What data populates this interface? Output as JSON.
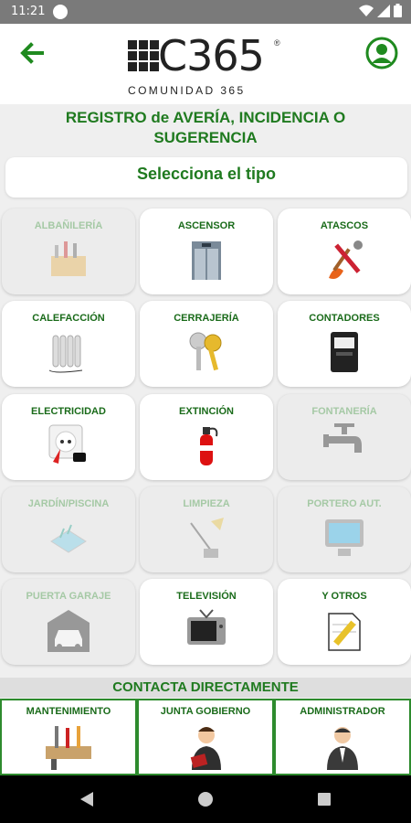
{
  "status": {
    "time": "11:21"
  },
  "app": {
    "logo_text": "C365",
    "logo_reg": "®",
    "logo_sub": "COMUNIDAD 365"
  },
  "page": {
    "title_line1": "REGISTRO de AVERÍA, INCIDENCIA O",
    "title_line2": "SUGERENCIA",
    "select_type": "Selecciona el tipo"
  },
  "categories": [
    {
      "label": "ALBAÑILERÍA",
      "icon": "toolbox-icon",
      "enabled": false
    },
    {
      "label": "ASCENSOR",
      "icon": "elevator-icon",
      "enabled": true
    },
    {
      "label": "ATASCOS",
      "icon": "plunger-wrench-icon",
      "enabled": true
    },
    {
      "label": "CALEFACCIÓN",
      "icon": "radiator-icon",
      "enabled": true
    },
    {
      "label": "CERRAJERÍA",
      "icon": "keys-icon",
      "enabled": true
    },
    {
      "label": "CONTADORES",
      "icon": "meter-icon",
      "enabled": true
    },
    {
      "label": "ELECTRICIDAD",
      "icon": "socket-plug-icon",
      "enabled": true
    },
    {
      "label": "EXTINCIÓN",
      "icon": "fire-extinguisher-icon",
      "enabled": true
    },
    {
      "label": "FONTANERÍA",
      "icon": "faucet-icon",
      "enabled": false
    },
    {
      "label": "JARDÍN/PISCINA",
      "icon": "pool-icon",
      "enabled": false
    },
    {
      "label": "LIMPIEZA",
      "icon": "mop-icon",
      "enabled": false
    },
    {
      "label": "PORTERO AUT.",
      "icon": "intercom-monitor-icon",
      "enabled": false
    },
    {
      "label": "PUERTA GARAJE",
      "icon": "garage-icon",
      "enabled": false
    },
    {
      "label": "TELEVISIÓN",
      "icon": "tv-icon",
      "enabled": true
    },
    {
      "label": "Y OTROS",
      "icon": "note-pencil-icon",
      "enabled": true
    }
  ],
  "contact": {
    "header": "CONTACTA DIRECTAMENTE",
    "items": [
      {
        "label": "MANTENIMIENTO",
        "icon": "tools-icon"
      },
      {
        "label": "JUNTA GOBIERNO",
        "icon": "person-book-icon"
      },
      {
        "label": "ADMINISTRADOR",
        "icon": "businessman-icon"
      }
    ]
  },
  "colors": {
    "accent": "#1f7a1f",
    "disabled_text": "#a5c9a5",
    "tile_bg": "#ffffff",
    "disabled_bg": "#ececec"
  }
}
